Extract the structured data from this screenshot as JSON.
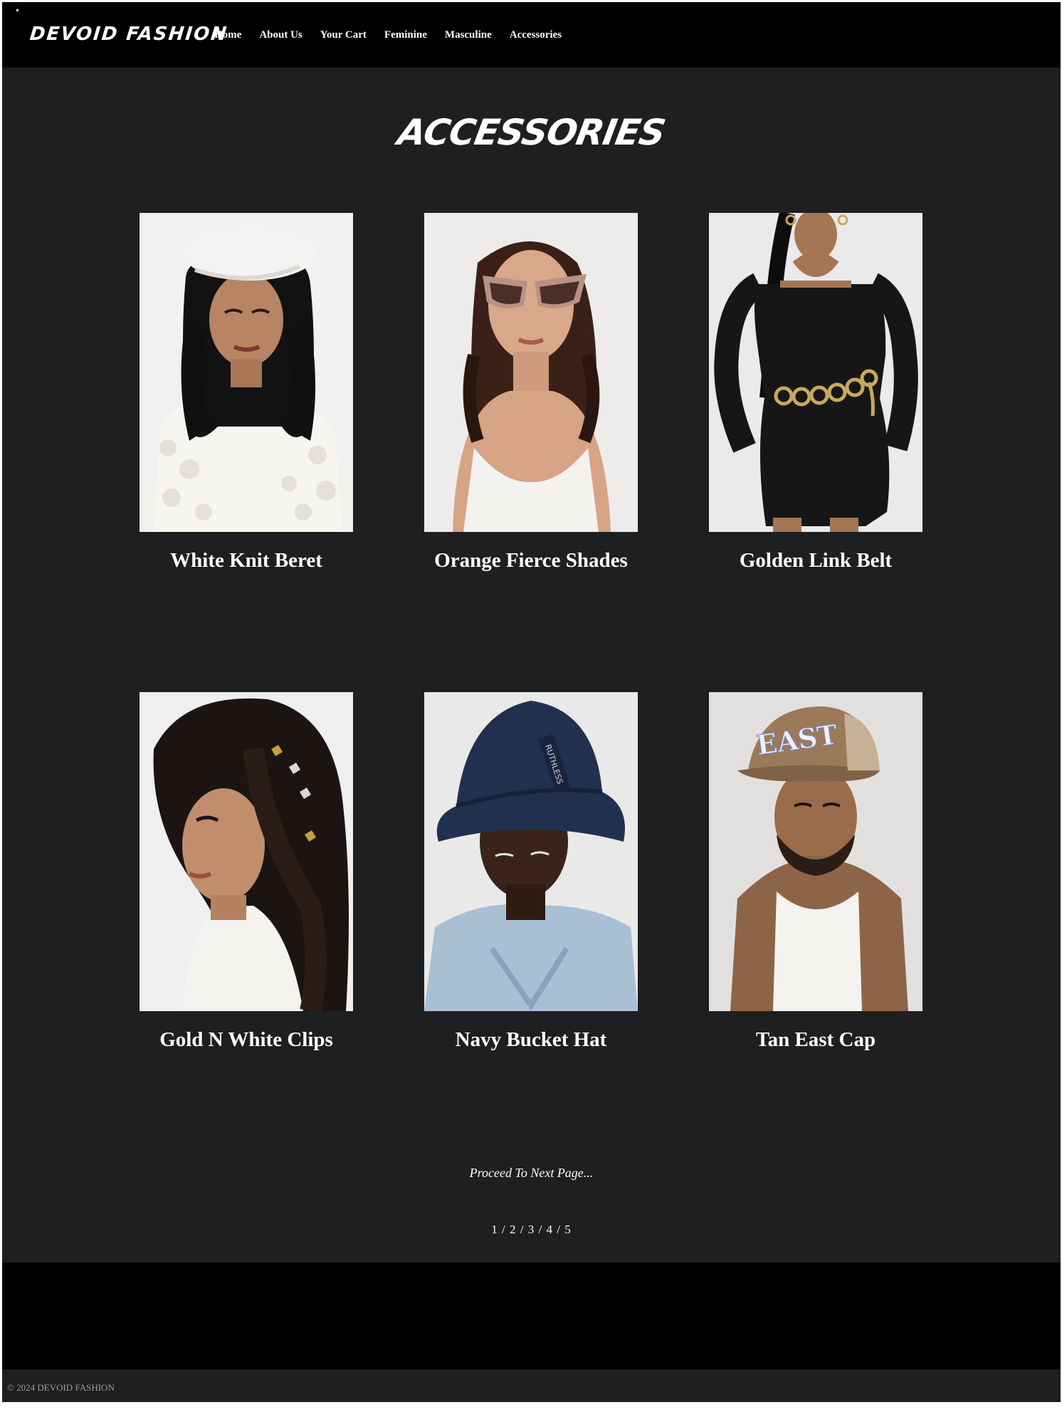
{
  "header": {
    "brand": "DEVOID FASHION",
    "nav": [
      "Home",
      "About Us",
      "Your Cart",
      "Feminine",
      "Masculine",
      "Accessories"
    ]
  },
  "page_title": "ACCESSORIES",
  "products": [
    {
      "name": "White Knit Beret"
    },
    {
      "name": "Orange Fierce Shades"
    },
    {
      "name": "Golden Link Belt"
    },
    {
      "name": "Gold N White Clips"
    },
    {
      "name": "Navy Bucket Hat"
    },
    {
      "name": "Tan East Cap"
    }
  ],
  "photo_text": {
    "bucket_hat_label": "RUTHLESS",
    "cap_logo": "EAST"
  },
  "proceed_text": "Proceed To Next Page...",
  "pagination": {
    "pages": [
      "1",
      "2",
      "3",
      "4",
      "5"
    ],
    "separator": " / "
  },
  "footer": {
    "copyright": "© 2024 DEVOID FASHION"
  },
  "colors": {
    "page_background": "#1e1f21",
    "header_background": "#000000",
    "text": "#ffffff",
    "footer_text": "#9b9b9b"
  }
}
